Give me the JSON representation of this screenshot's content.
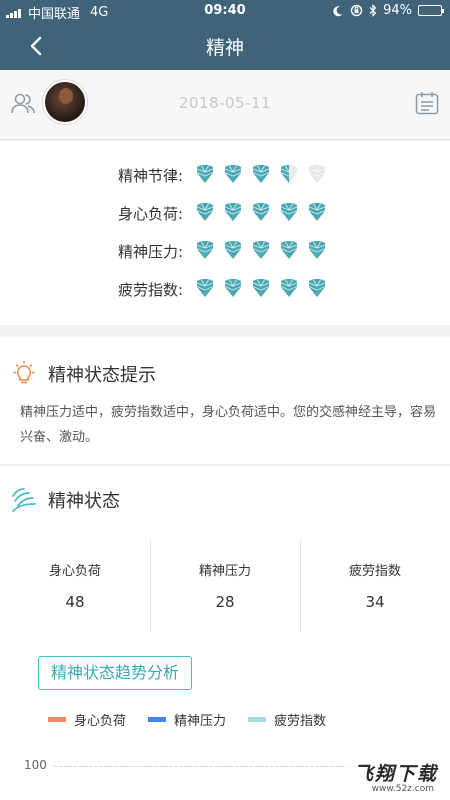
{
  "status_bar": {
    "carrier": "中国联通",
    "network": "4G",
    "time": "09:40",
    "battery": "94%",
    "battery_level": 0.94
  },
  "nav": {
    "title": "精神"
  },
  "user_bar": {
    "date": "2018-05-11"
  },
  "ratings": [
    {
      "label": "精神节律:",
      "stars": 3.5,
      "max": 5
    },
    {
      "label": "身心负荷:",
      "stars": 5,
      "max": 5
    },
    {
      "label": "精神压力:",
      "stars": 5,
      "max": 5
    },
    {
      "label": "疲劳指数:",
      "stars": 5,
      "max": 5
    }
  ],
  "tips": {
    "heading": "精神状态提示",
    "text": "精神压力适中，疲劳指数适中，身心负荷适中。您的交感神经主导，容易兴奋、激动。"
  },
  "state": {
    "heading": "精神状态",
    "metrics": [
      {
        "label": "身心负荷",
        "value": "48"
      },
      {
        "label": "精神压力",
        "value": "28"
      },
      {
        "label": "疲劳指数",
        "value": "34"
      }
    ],
    "trend_button": "精神状态趋势分析",
    "legend": [
      {
        "name": "身心负荷",
        "color": "#ee8a66"
      },
      {
        "name": "精神压力",
        "color": "#3d8be0"
      },
      {
        "name": "疲劳指数",
        "color": "#a4dbe3"
      }
    ],
    "y_tick_top": "100"
  },
  "colors": {
    "header": "#3f6479",
    "gem": "#4aa9b5",
    "accent": "#3aa9b3",
    "tip_icon": "#f08a48"
  },
  "watermark": {
    "main": "飞翔下载",
    "sub": "www.52z.com"
  }
}
